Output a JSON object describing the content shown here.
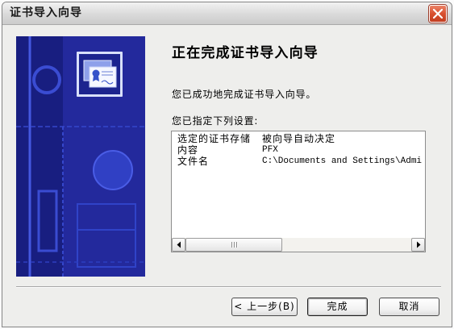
{
  "window": {
    "title": "证书导入向导",
    "close_icon": "close-icon"
  },
  "wizard": {
    "banner_icon": "certificate-icon",
    "heading": "正在完成证书导入向导",
    "success_text": "您已成功地完成证书导入向导。",
    "settings_label": "您已指定下列设置:"
  },
  "settings_list": {
    "rows": [
      {
        "name": "选定的证书存储",
        "value": "被向导自动决定"
      },
      {
        "name": "内容",
        "value": "PFX"
      },
      {
        "name": "文件名",
        "value": "C:\\Documents and Settings\\Admi"
      }
    ],
    "scrollbar": {
      "position": 0,
      "thumb_fraction": 0.43,
      "left_icon": "scroll-left-arrow-icon",
      "right_icon": "scroll-right-arrow-icon"
    }
  },
  "buttons": {
    "back": {
      "label": "< 上一步(B)",
      "enabled": true
    },
    "finish": {
      "label": "完成",
      "focused": true
    },
    "cancel": {
      "label": "取消"
    }
  },
  "colors": {
    "banner_blue": "#23299c",
    "close_red": "#d8502f"
  }
}
